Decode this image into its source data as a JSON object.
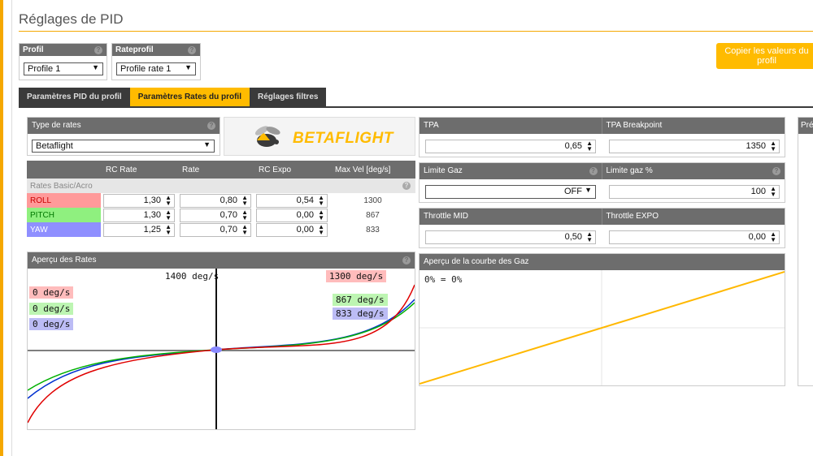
{
  "page": {
    "title": "Réglages de PID"
  },
  "profile": {
    "label": "Profil",
    "value": "Profile 1"
  },
  "rateprofile": {
    "label": "Rateprofil",
    "value": "Profile rate 1"
  },
  "copy_button": {
    "label": "Copier les valeurs du profil"
  },
  "tabs": [
    {
      "label": "Paramètres PID du profil",
      "active": false
    },
    {
      "label": "Paramètres Rates du profil",
      "active": true
    },
    {
      "label": "Réglages filtres",
      "active": false
    }
  ],
  "rates_type": {
    "label": "Type de rates",
    "value": "Betaflight"
  },
  "logo": {
    "text": "BETAFLIGHT"
  },
  "rates_table": {
    "headers": [
      "",
      "RC Rate",
      "Rate",
      "RC Expo",
      "Max Vel [deg/s]"
    ],
    "section_label": "Rates Basic/Acro",
    "rows": [
      {
        "axis": "ROLL",
        "rc_rate": "1,30",
        "rate": "0,80",
        "rc_expo": "0,54",
        "max_vel": "1300",
        "color": "#ff9a9a"
      },
      {
        "axis": "PITCH",
        "rc_rate": "1,30",
        "rate": "0,70",
        "rc_expo": "0,00",
        "max_vel": "867",
        "color": "#8ff07f"
      },
      {
        "axis": "YAW",
        "rc_rate": "1,25",
        "rate": "0,70",
        "rc_expo": "0,00",
        "max_vel": "833",
        "color": "#8f8fff"
      }
    ]
  },
  "rates_preview": {
    "title": "Aperçu des Rates",
    "center_label": "1400 deg/s",
    "left_labels": [
      "0 deg/s",
      "0 deg/s",
      "0 deg/s"
    ],
    "right_labels": [
      "1300 deg/s",
      "867 deg/s",
      "833 deg/s"
    ]
  },
  "tpa": {
    "label": "TPA",
    "value": "0,65"
  },
  "tpa_breakpoint": {
    "label": "TPA Breakpoint",
    "value": "1350"
  },
  "throttle_limit": {
    "label": "Limite Gaz",
    "value": "OFF"
  },
  "throttle_limit_pct": {
    "label": "Limite gaz %",
    "value": "100"
  },
  "throttle_mid": {
    "label": "Throttle MID",
    "value": "0,50"
  },
  "throttle_expo": {
    "label": "Throttle EXPO",
    "value": "0,00"
  },
  "throttle_curve": {
    "title": "Aperçu de la courbe des Gaz",
    "readout": "0% = 0%"
  },
  "side_panel": {
    "label": "Pré"
  },
  "colors": {
    "accent": "#ffbb00",
    "roll": "#e00000",
    "pitch": "#00b000",
    "yaw": "#0030d0",
    "throttle": "#ffb800"
  }
}
